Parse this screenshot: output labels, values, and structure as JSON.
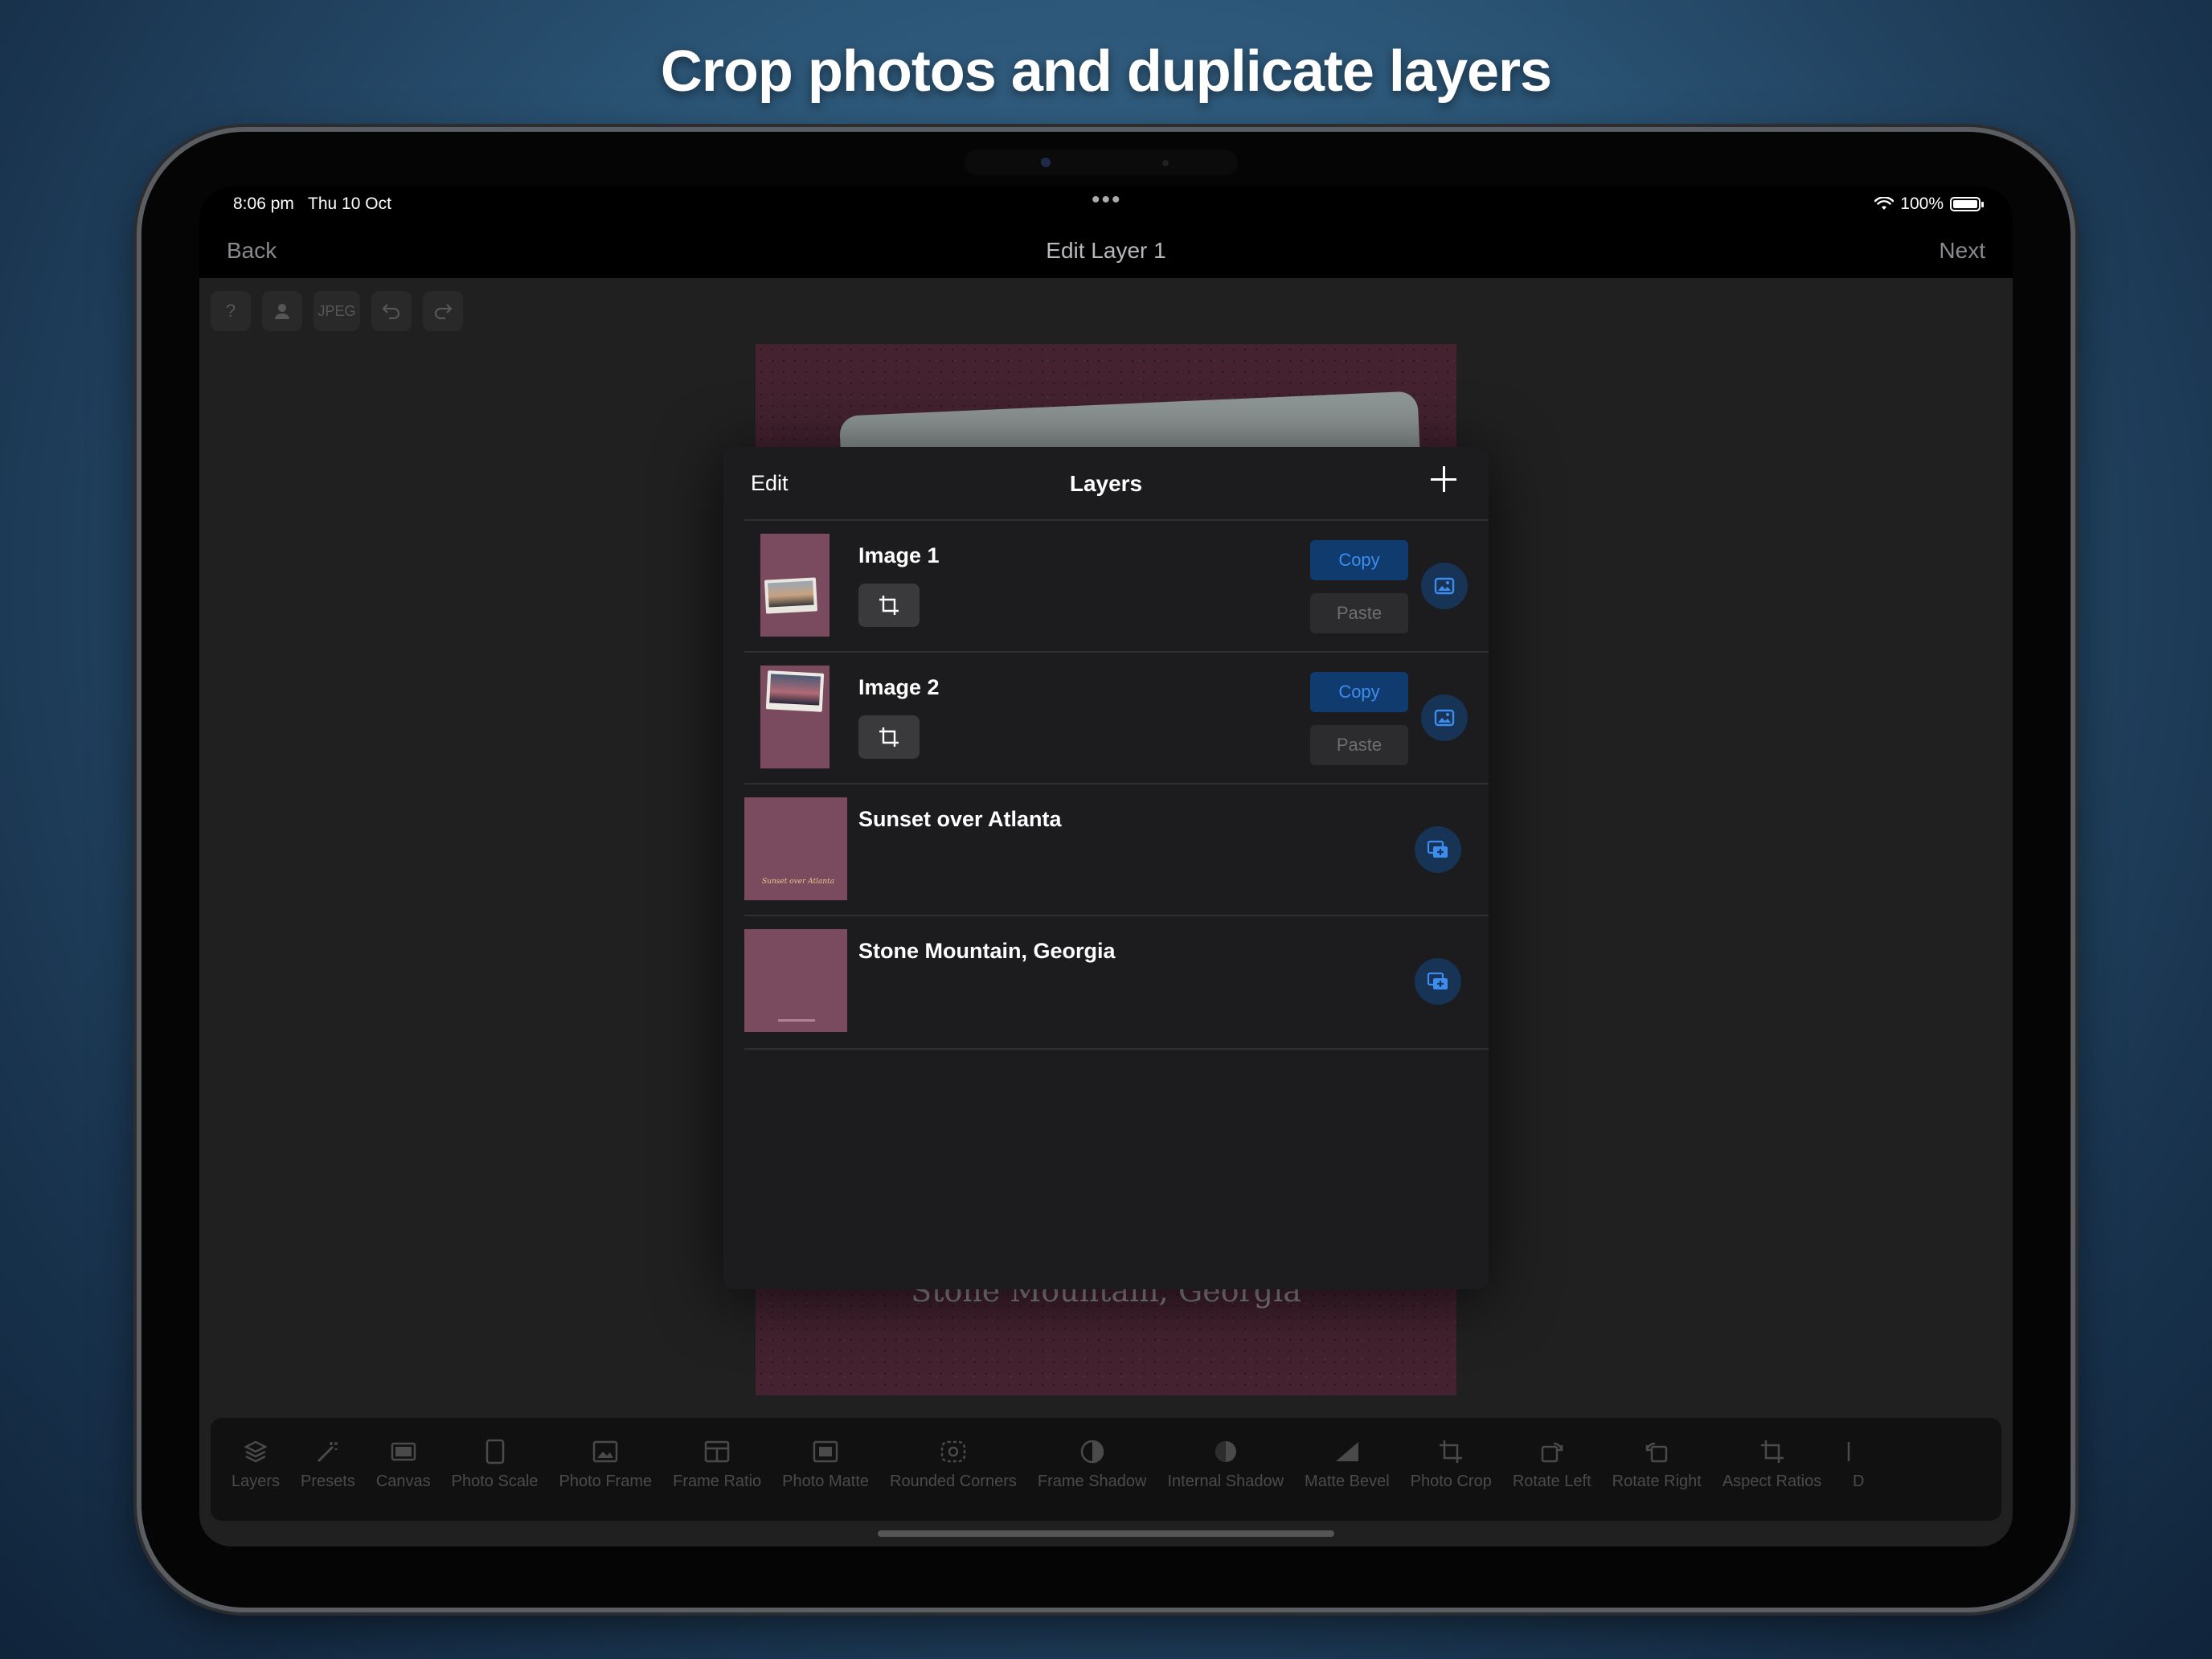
{
  "headline": "Crop photos and duplicate layers",
  "status_bar": {
    "time": "8:06 pm",
    "date": "Thu 10 Oct",
    "dots": "•••",
    "battery": "100%"
  },
  "nav": {
    "back": "Back",
    "title": "Edit Layer 1",
    "next": "Next"
  },
  "top_toolbar": {
    "format_label": "JPEG"
  },
  "canvas": {
    "caption": "Stone Mountain, Georgia",
    "thumb_script": "Sunset over Atlanta"
  },
  "popover": {
    "edit_label": "Edit",
    "title": "Layers",
    "rows": [
      {
        "name": "Image 1",
        "copy": "Copy",
        "paste": "Paste"
      },
      {
        "name": "Image 2",
        "copy": "Copy",
        "paste": "Paste"
      },
      {
        "name": "Sunset over Atlanta"
      },
      {
        "name": "Stone Mountain, Georgia"
      }
    ]
  },
  "bottom_tools": [
    "Layers",
    "Presets",
    "Canvas",
    "Photo Scale",
    "Photo Frame",
    "Frame Ratio",
    "Photo Matte",
    "Rounded Corners",
    "Frame Shadow",
    "Internal Shadow",
    "Matte Bevel",
    "Photo Crop",
    "Rotate Left",
    "Rotate Right",
    "Aspect Ratios",
    "D"
  ],
  "colors": {
    "accent": "#3d8df0",
    "copy_bg": "#0f3b6e",
    "layer_thumb": "#7a4a5e"
  }
}
